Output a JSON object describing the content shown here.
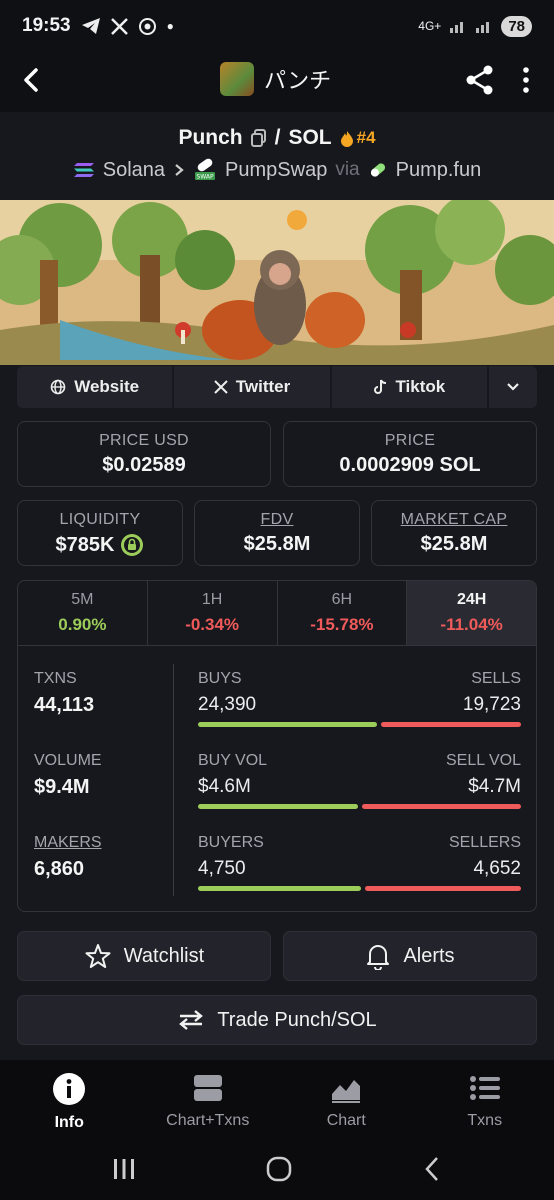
{
  "status": {
    "time": "19:53",
    "network": "4G+",
    "battery": "78"
  },
  "header": {
    "title": "パンチ"
  },
  "pair": {
    "base": "Punch",
    "separator": "/",
    "quote": "SOL",
    "rank": "#4"
  },
  "chain": {
    "name": "Solana",
    "dex": "PumpSwap",
    "via": "via",
    "launchpad": "Pump.fun",
    "dex_badge": "SWAP"
  },
  "links": {
    "website": "Website",
    "twitter": "Twitter",
    "tiktok": "Tiktok"
  },
  "prices": {
    "usd_label": "PRICE USD",
    "usd_value": "$0.02589",
    "native_label": "PRICE",
    "native_value": "0.0002909 SOL"
  },
  "metrics": {
    "liquidity_label": "LIQUIDITY",
    "liquidity_value": "$785K",
    "fdv_label": "FDV",
    "fdv_value": "$25.8M",
    "mcap_label": "MARKET CAP",
    "mcap_value": "$25.8M"
  },
  "periods": [
    {
      "label": "5M",
      "value": "0.90%"
    },
    {
      "label": "1H",
      "value": "-0.34%"
    },
    {
      "label": "6H",
      "value": "-15.78%"
    },
    {
      "label": "24H",
      "value": "-11.04%"
    }
  ],
  "stats": {
    "txns_label": "TXNS",
    "txns_value": "44,113",
    "volume_label": "VOLUME",
    "volume_value": "$9.4M",
    "makers_label": "MAKERS",
    "makers_value": "6,860",
    "buys_label": "BUYS",
    "buys_value": "24,390",
    "sells_label": "SELLS",
    "sells_value": "19,723",
    "buyvol_label": "BUY VOL",
    "buyvol_value": "$4.6M",
    "sellvol_label": "SELL VOL",
    "sellvol_value": "$4.7M",
    "buyers_label": "BUYERS",
    "buyers_value": "4,750",
    "sellers_label": "SELLERS",
    "sellers_value": "4,652",
    "buy_ratio_txns": 0.553,
    "buy_ratio_vol": 0.495,
    "buy_ratio_makers": 0.505
  },
  "actions": {
    "watchlist": "Watchlist",
    "alerts": "Alerts",
    "trade": "Trade Punch/SOL"
  },
  "nav": {
    "info": "Info",
    "chart_txns": "Chart+Txns",
    "chart": "Chart",
    "txns": "Txns"
  },
  "colors": {
    "positive": "#9ccc5a",
    "negative": "#ef5a5a",
    "rank": "#f5a623"
  }
}
